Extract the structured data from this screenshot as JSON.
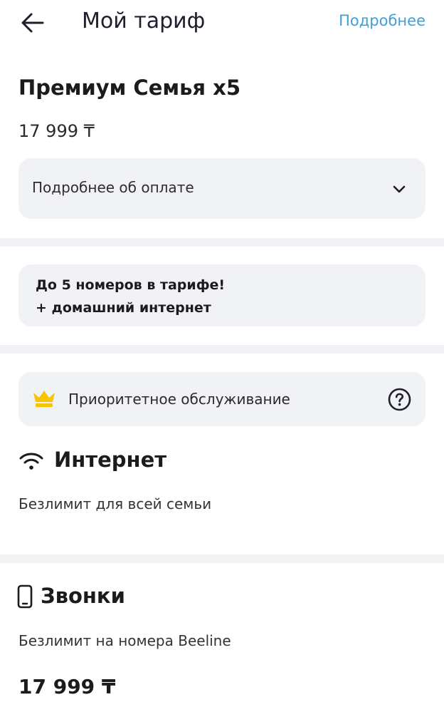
{
  "header": {
    "back_icon": "arrow-left-icon",
    "title": "Мой тариф",
    "more_link": "Подробнее"
  },
  "plan": {
    "name": "Премиум Семья x5",
    "price": "17 999 ₸",
    "payment_details_label": "Подробнее об оплате",
    "payment_details_icon": "chevron-down-icon"
  },
  "promo": {
    "line1": "До 5 номеров в тарифе!",
    "line2": "+ домашний интернет"
  },
  "priority": {
    "icon": "crown-icon",
    "label": "Приоритетное обслуживание",
    "help_icon": "question-circle-icon",
    "crown_color": "#f7c600"
  },
  "internet": {
    "icon": "wifi-icon",
    "title": "Интернет",
    "description": "Безлимит для всей семьи"
  },
  "calls": {
    "icon": "phone-icon",
    "title": "Звонки",
    "description": "Безлимит на номера Beeline",
    "price": "17 999 ₸"
  },
  "colors": {
    "accent_link": "#3f9fd8",
    "card_background": "#f1f2f6",
    "text_primary": "#1b1b1b"
  }
}
